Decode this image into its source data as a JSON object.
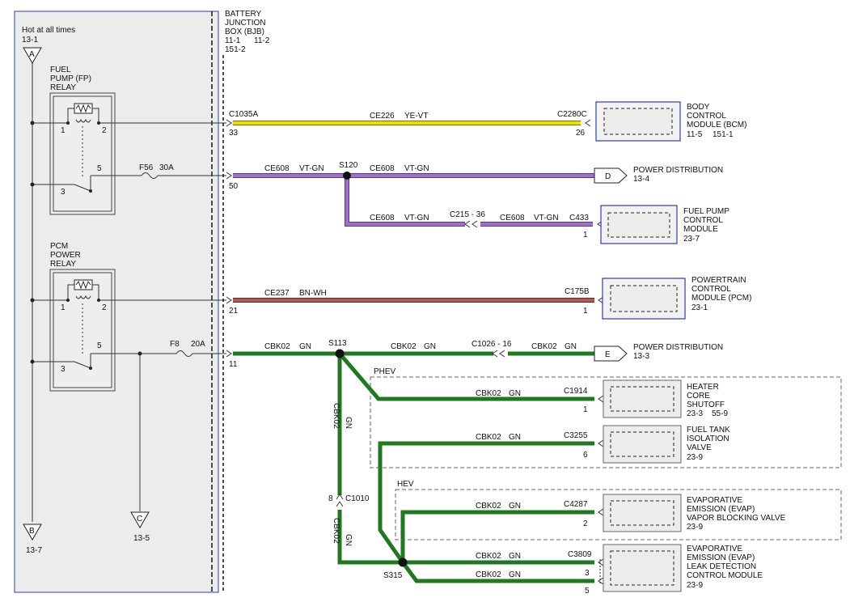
{
  "power_panel": {
    "hot_label": "Hot at all times",
    "hot_ref": "13-1",
    "connector_a": "A",
    "connector_b": "B",
    "connector_b_ref": "13-7",
    "connector_c": "C",
    "connector_c_ref": "13-5"
  },
  "bjb": {
    "title_lines": [
      "BATTERY",
      "JUNCTION",
      "BOX (BJB)"
    ],
    "ref_line1_a": "11-1",
    "ref_line1_b": "11-2",
    "ref_line2": "151-2"
  },
  "fp_relay": {
    "name_lines": [
      "FUEL",
      "PUMP (FP)",
      "RELAY"
    ],
    "pin1": "1",
    "pin2": "2",
    "pin3": "3",
    "pin5": "5"
  },
  "pcm_relay": {
    "name_lines": [
      "PCM",
      "POWER",
      "RELAY"
    ],
    "pin1": "1",
    "pin2": "2",
    "pin3": "3",
    "pin5": "5"
  },
  "fuses": {
    "f56": "F56",
    "f56_rating": "30A",
    "f8": "F8",
    "f8_rating": "20A"
  },
  "colors": {
    "yellow": "#e8e000",
    "violet": "#a070c8",
    "brown": "#b05a52",
    "green": "#1f7a1f",
    "blue": "#2e3bb0"
  },
  "circuits": {
    "bcm_wire": {
      "connector": "C1035A",
      "pin": "33",
      "circuit": "CE226",
      "color": "YE-VT",
      "end_connector": "C2280C",
      "end_pin": "26"
    },
    "ce608_main": {
      "pin": "50",
      "circuit1": "CE608",
      "color1": "VT-GN",
      "splice": "S120",
      "circuit2": "CE608",
      "color2": "VT-GN"
    },
    "ce608_branch": {
      "circuit_a": "CE608",
      "color_a": "VT-GN",
      "inline": "C215",
      "inline_pin": "36",
      "circuit_b": "CE608",
      "color_b": "VT-GN",
      "end_connector": "C433",
      "end_pin": "1"
    },
    "ce237": {
      "pin": "21",
      "circuit": "CE237",
      "color": "BN-WH",
      "end_connector": "C175B",
      "end_pin": "1"
    },
    "cbk02_main": {
      "pin": "11",
      "circuit1": "CBK02",
      "color1": "GN",
      "splice": "S113",
      "circuit2": "CBK02",
      "color2": "GN",
      "inline": "C1026",
      "inline_pin": "16",
      "circuit3": "CBK02",
      "color3": "GN"
    },
    "vertical_upper": {
      "circuit": "CBK02",
      "color": "GN"
    },
    "vertical_lower": {
      "circuit": "CBK02",
      "color": "GN"
    },
    "c1010": {
      "pin": "8",
      "connector": "C1010"
    },
    "s315": "S315",
    "heater": {
      "circuit": "CBK02",
      "color": "GN",
      "connector": "C1914",
      "pin": "1"
    },
    "tank": {
      "circuit": "CBK02",
      "color": "GN",
      "connector": "C3255",
      "pin": "6"
    },
    "evap_vbv": {
      "circuit": "CBK02",
      "color": "GN",
      "connector": "C4287",
      "pin": "2"
    },
    "evap_ldcm1": {
      "circuit": "CBK02",
      "color": "GN",
      "connector": "C3809",
      "pin": "3"
    },
    "evap_ldcm2": {
      "circuit": "CBK02",
      "color": "GN",
      "pin": "5"
    }
  },
  "regions": {
    "phev": "PHEV",
    "hev": "HEV"
  },
  "destinations": {
    "bcm": {
      "lines": [
        "BODY",
        "CONTROL",
        "MODULE (BCM)"
      ],
      "ref_a": "11-5",
      "ref_b": "151-1"
    },
    "power_d": {
      "letter": "D",
      "label": "POWER DISTRIBUTION",
      "ref": "13-4"
    },
    "fpcm": {
      "lines": [
        "FUEL PUMP",
        "CONTROL",
        "MODULE"
      ],
      "ref": "23-7"
    },
    "pcm": {
      "lines": [
        "POWERTRAIN",
        "CONTROL",
        "MODULE (PCM)"
      ],
      "ref": "23-1"
    },
    "power_e": {
      "letter": "E",
      "label": "POWER DISTRIBUTION",
      "ref": "13-3"
    },
    "heater": {
      "lines": [
        "HEATER",
        "CORE",
        "SHUTOFF"
      ],
      "ref_a": "23-3",
      "ref_b": "55-9"
    },
    "tank": {
      "lines": [
        "FUEL TANK",
        "ISOLATION",
        "VALVE"
      ],
      "ref": "23-9"
    },
    "evap_vbv": {
      "lines": [
        "EVAPORATIVE",
        "EMISSION (EVAP)",
        "VAPOR BLOCKING VALVE"
      ],
      "ref": "23-9"
    },
    "evap_ldcm": {
      "lines": [
        "EVAPORATIVE",
        "EMISSION (EVAP)",
        "LEAK DETECTION",
        "CONTROL MODULE"
      ],
      "ref": "23-9"
    }
  }
}
